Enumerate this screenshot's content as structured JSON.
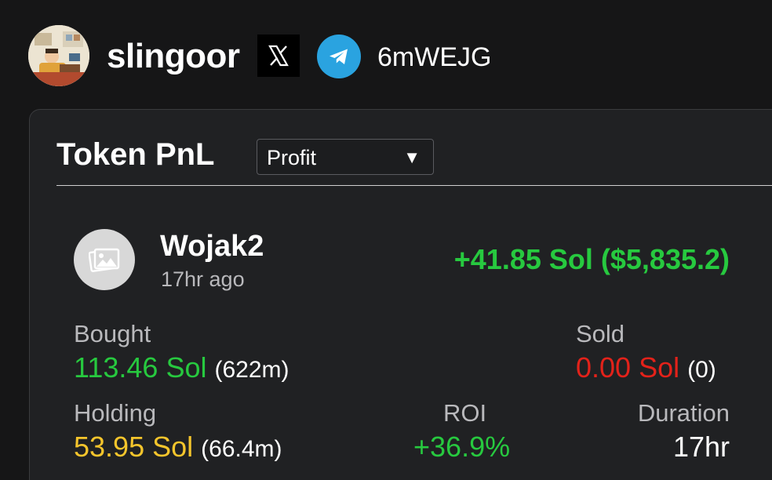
{
  "profile": {
    "username": "slingoor",
    "telegram_handle": "6mWEJG",
    "social_icons": [
      "x-logo-icon",
      "telegram-icon"
    ]
  },
  "card": {
    "title": "Token PnL",
    "filter": {
      "selected": "Profit",
      "arrow": "▼"
    },
    "token": {
      "name": "Wojak2",
      "time_ago": "17hr ago",
      "pnl": "+41.85 Sol ($5,835.2)"
    },
    "stats": {
      "bought_label": "Bought",
      "bought_value": "113.46 Sol",
      "bought_count": "(622m)",
      "sold_label": "Sold",
      "sold_value": "0.00 Sol",
      "sold_count": "(0)",
      "holding_label": "Holding",
      "holding_value": "53.95 Sol",
      "holding_count": "(66.4m)",
      "roi_label": "ROI",
      "roi_value": "+36.9%",
      "duration_label": "Duration",
      "duration_value": "17hr"
    }
  },
  "colors": {
    "background": "#161617",
    "card": "#202123",
    "profit_green": "#27c93f",
    "loss_red": "#e3221a",
    "holding_yellow": "#f5c52c",
    "telegram_blue": "#2aa3e0"
  }
}
